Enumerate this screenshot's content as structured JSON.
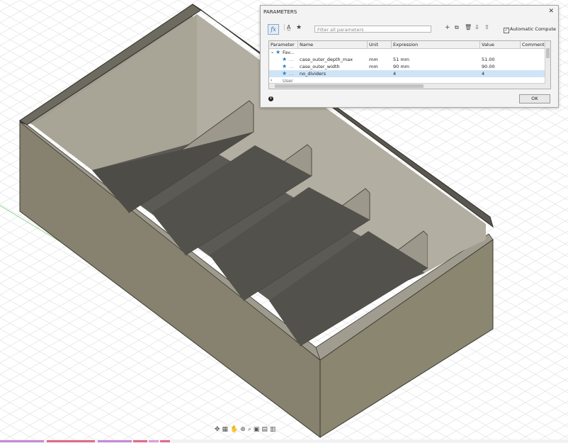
{
  "dialog": {
    "title": "PARAMETERS",
    "close_icon": "close-icon",
    "filter_placeholder": "Filter all parameters",
    "automatic_compute_label": "Automatic Compute",
    "automatic_compute_checked": true,
    "ok_label": "OK",
    "columns": [
      "Parameter",
      "Name",
      "Unit",
      "Expression",
      "Value",
      "Comments"
    ],
    "group_label": "Fav...",
    "rows": [
      {
        "name": "case_outer_depth_max",
        "unit": "mm",
        "expression": "51 mm",
        "value": "51.00"
      },
      {
        "name": "case_outer_width",
        "unit": "mm",
        "expression": "90 mm",
        "value": "90.00"
      },
      {
        "name": "no_dividers",
        "unit": "",
        "expression": "4",
        "value": "4"
      }
    ],
    "user_group_label": "User",
    "toolbar_icons": [
      "function-icon",
      "text-format-icon",
      "star-icon",
      "add-icon",
      "copy-icon",
      "delete-icon",
      "import-icon",
      "export-icon"
    ]
  },
  "viewport": {
    "colors": {
      "top_face": "#8a857c",
      "front_face": "#86826f",
      "divider": "#9a968a",
      "floor": "#5c5a54",
      "grid": "#e3e3e3"
    }
  },
  "navbar_icons": [
    "orbit-icon",
    "look-at-icon",
    "pan-icon",
    "zoom-icon",
    "fit-icon",
    "display-settings-icon",
    "grid-settings-icon",
    "viewport-icon"
  ]
}
